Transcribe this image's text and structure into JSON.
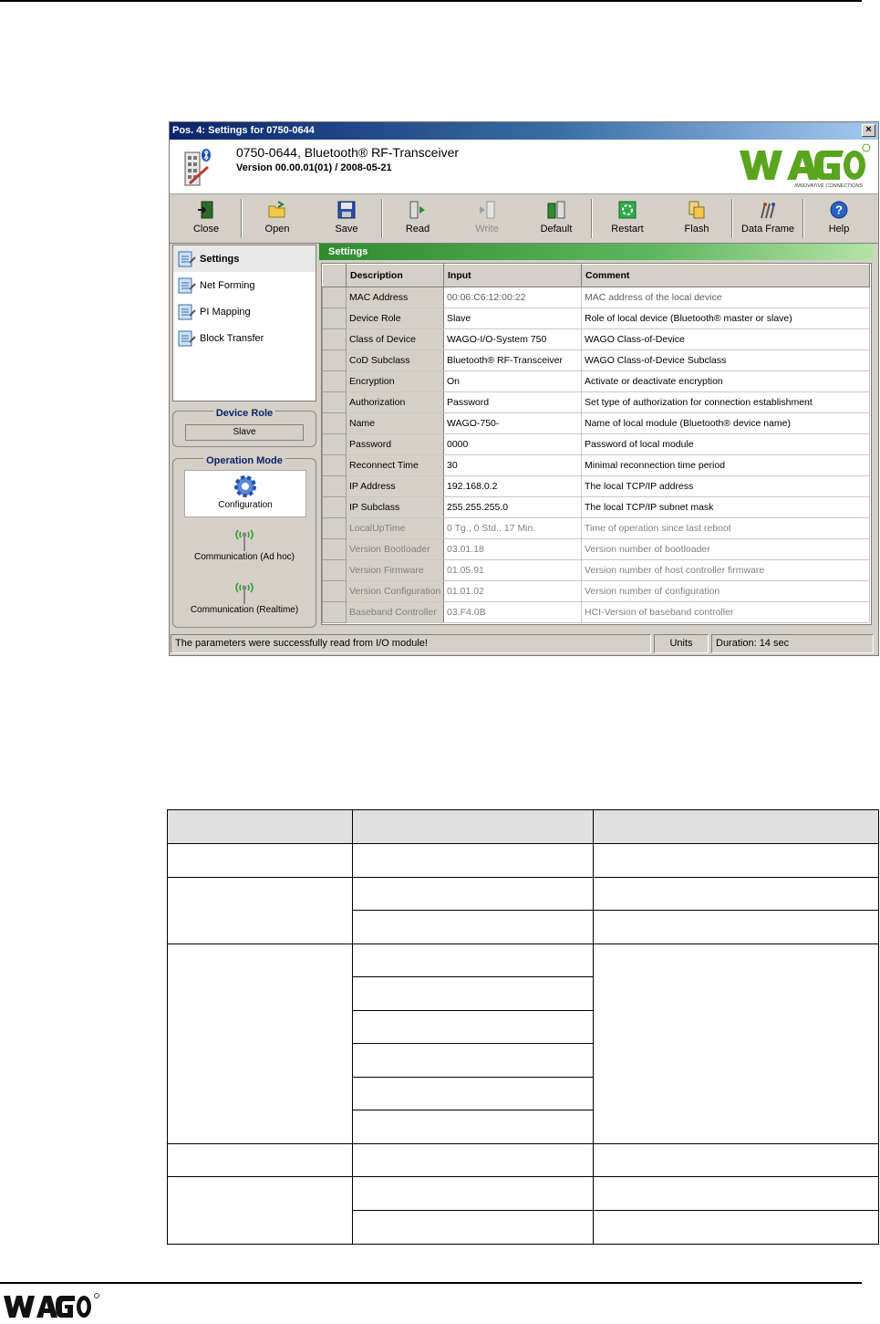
{
  "window": {
    "title": "Pos. 4: Settings for 0750-0644",
    "close_glyph": "×"
  },
  "header": {
    "device_title": "0750-0644, Bluetooth® RF-Transceiver",
    "version": "Version 00.00.01(01) / 2008-05-21",
    "logo": {
      "brand": "WAGO",
      "tagline": "INNOVATIVE CONNECTIONS",
      "brand_color": "#5aa51e"
    }
  },
  "toolbar": [
    {
      "label": "Close",
      "icon": "door-exit-icon",
      "enabled": true
    },
    {
      "label": "Open",
      "icon": "folder-open-icon",
      "enabled": true
    },
    {
      "label": "Save",
      "icon": "floppy-disk-icon",
      "enabled": true
    },
    {
      "label": "Read",
      "icon": "read-module-icon",
      "enabled": true
    },
    {
      "label": "Write",
      "icon": "write-module-icon",
      "enabled": false
    },
    {
      "label": "Default",
      "icon": "default-module-icon",
      "enabled": true
    },
    {
      "label": "Restart",
      "icon": "restart-icon",
      "enabled": true
    },
    {
      "label": "Flash",
      "icon": "flash-icon",
      "enabled": true
    },
    {
      "label": "Data Frame",
      "icon": "data-frame-icon",
      "enabled": true
    },
    {
      "label": "Help",
      "icon": "help-icon",
      "enabled": true
    }
  ],
  "nav": [
    {
      "label": "Settings",
      "active": true
    },
    {
      "label": "Net Forming",
      "active": false
    },
    {
      "label": "PI Mapping",
      "active": false
    },
    {
      "label": "Block Transfer",
      "active": false
    }
  ],
  "device_role": {
    "title": "Device Role",
    "value": "Slave"
  },
  "operation_mode": {
    "title": "Operation Mode",
    "items": [
      {
        "label": "Configuration",
        "icon": "gear-icon",
        "selected": true
      },
      {
        "label": "Communication (Ad hoc)",
        "icon": "antenna-icon",
        "selected": false
      },
      {
        "label": "Communication (Realtime)",
        "icon": "antenna-icon",
        "selected": false
      }
    ]
  },
  "settings": {
    "title": "Settings",
    "columns": [
      "Description",
      "Input",
      "Comment"
    ],
    "rows": [
      {
        "description": "MAC Address",
        "input": "00:06:C6:12:00:22",
        "comment": "MAC address of the local device",
        "state": "dim"
      },
      {
        "description": "Device Role",
        "input": "Slave",
        "comment": "Role of local device (Bluetooth® master or slave)",
        "state": "normal"
      },
      {
        "description": "Class of Device",
        "input": "WAGO-I/O-System 750",
        "comment": "WAGO Class-of-Device",
        "state": "normal"
      },
      {
        "description": "CoD Subclass",
        "input": "Bluetooth® RF-Transceiver",
        "comment": "WAGO Class-of-Device Subclass",
        "state": "normal"
      },
      {
        "description": "Encryption",
        "input": "On",
        "comment": "Activate or deactivate encryption",
        "state": "normal"
      },
      {
        "description": "Authorization",
        "input": "Password",
        "comment": "Set type of authorization for connection establishment",
        "state": "normal"
      },
      {
        "description": "Name",
        "input": "WAGO-750-",
        "comment": "Name of local module (Bluetooth® device name)",
        "state": "normal"
      },
      {
        "description": "Password",
        "input": "0000",
        "comment": "Password of local module",
        "state": "normal"
      },
      {
        "description": "Reconnect Time",
        "input": "30",
        "comment": "Minimal reconnection time period",
        "state": "normal"
      },
      {
        "description": "IP Address",
        "input": "192.168.0.2",
        "comment": "The local TCP/IP address",
        "state": "normal"
      },
      {
        "description": "IP Subclass",
        "input": "255.255.255.0",
        "comment": "The local TCP/IP subnet mask",
        "state": "normal"
      },
      {
        "description": "LocalUpTime",
        "input": "0 Tg., 0 Std., 17 Min.",
        "comment": "Time of operation since last reboot",
        "state": "readonly"
      },
      {
        "description": "Version Bootloader",
        "input": "03.01.18",
        "comment": "Version number of bootloader",
        "state": "readonly"
      },
      {
        "description": "Version Firmware",
        "input": "01.05.91",
        "comment": "Version number of host controller firmware",
        "state": "readonly"
      },
      {
        "description": "Version Configuration",
        "input": "01.01.02",
        "comment": "Version number of configuration",
        "state": "readonly"
      },
      {
        "description": "Baseband Controller",
        "input": "03.F4.0B",
        "comment": "HCI-Version of baseband controller",
        "state": "readonly"
      }
    ]
  },
  "status": {
    "message": "The parameters were successfully read from I/O module!",
    "units": "Units",
    "duration": "Duration: 14 sec"
  }
}
